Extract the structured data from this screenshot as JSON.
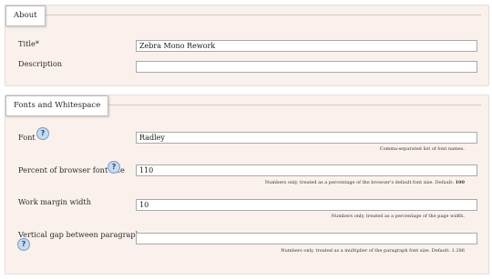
{
  "about": {
    "legend": "About",
    "title_label": "Title*",
    "title_value": "Zebra Mono Rework",
    "description_label": "Description",
    "description_value": ""
  },
  "fonts": {
    "legend": "Fonts and Whitespace",
    "font_label": "Font",
    "font_value": "Radley",
    "font_help": "Comma-separated list of font names.",
    "size_label": "Percent of browser font size",
    "size_value": "110",
    "size_help_text": "Numbers only, treated as a percentage of the browser's default font size. Default: ",
    "size_help_default": "100",
    "margin_label": "Work margin width",
    "margin_value": "10",
    "margin_help": "Numbers only, treated as a percentage of the page width.",
    "gap_label": "Vertical gap between paragraphs",
    "gap_value": "",
    "gap_help": "Numbers only, treated as a multiplier of the paragraph font size. Default: 1.286",
    "help_glyph": "?"
  },
  "icons": {
    "help": "question-circle-icon"
  }
}
